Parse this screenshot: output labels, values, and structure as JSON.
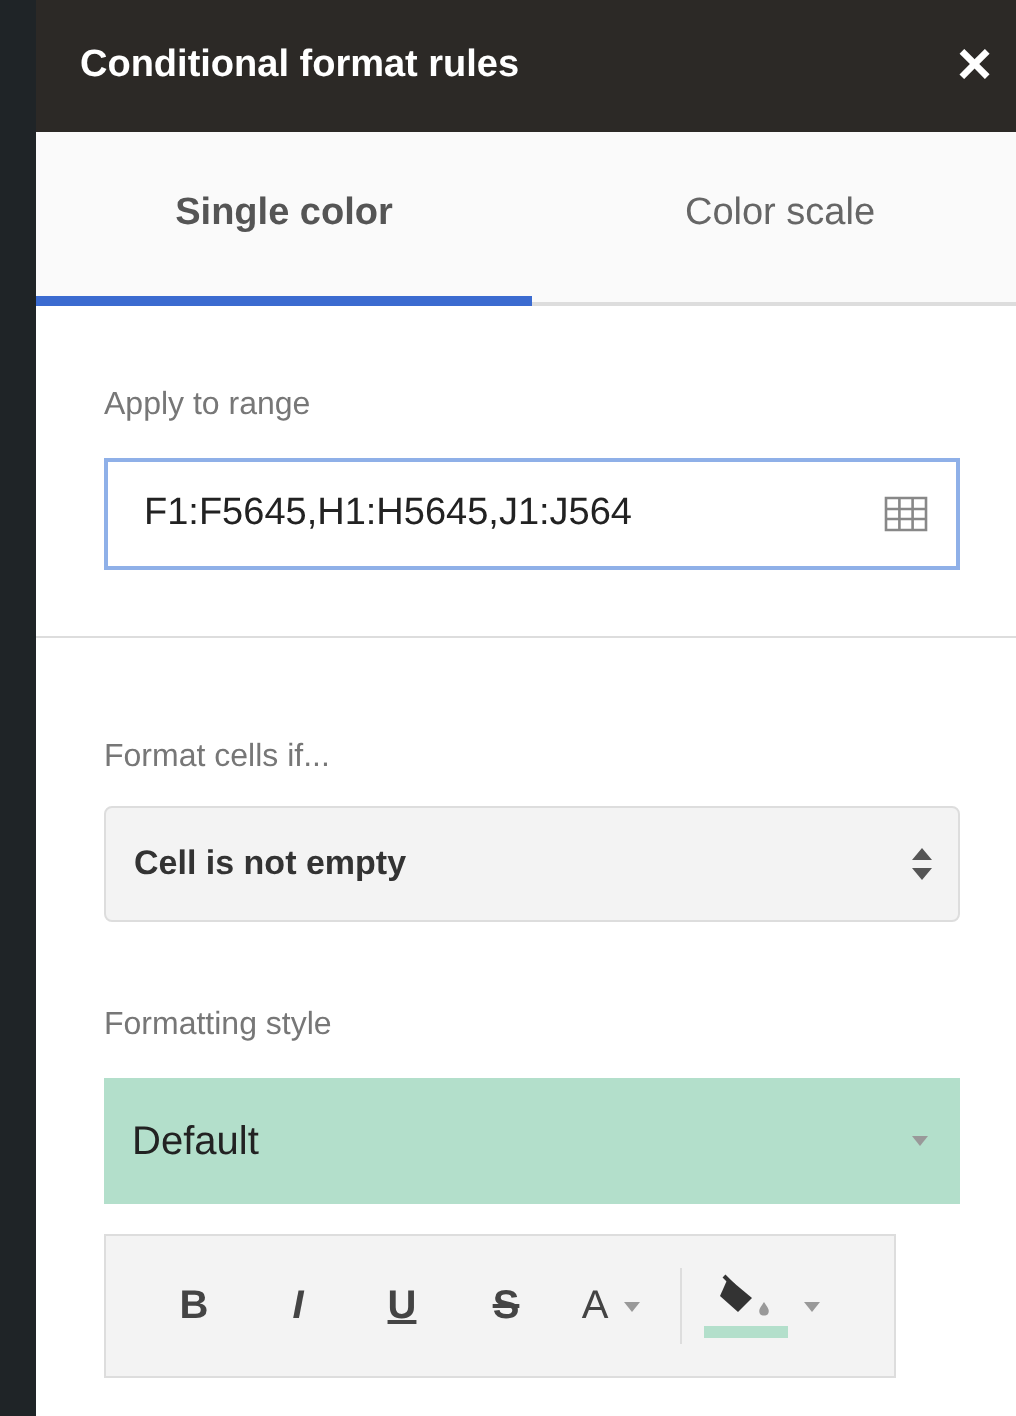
{
  "panel": {
    "title": "Conditional format rules",
    "close": "×"
  },
  "tabs": [
    {
      "label": "Single color",
      "selected": true
    },
    {
      "label": "Color scale",
      "selected": false
    }
  ],
  "range": {
    "label": "Apply to range",
    "value": "F1:F5645,H1:H5645,J1:J564"
  },
  "condition": {
    "label": "Format cells if...",
    "value": "Cell is not empty"
  },
  "style": {
    "label": "Formatting style",
    "value": "Default",
    "color": "#b3dfcb"
  },
  "toolbar": [
    {
      "kind": "bold",
      "label": "B"
    },
    {
      "kind": "italic",
      "label": "I"
    },
    {
      "kind": "underline",
      "label": "U"
    },
    {
      "kind": "strike",
      "label": "S"
    },
    {
      "kind": "color",
      "label": "A"
    },
    {
      "kind": "fill",
      "color": "#b3dfcb"
    }
  ]
}
